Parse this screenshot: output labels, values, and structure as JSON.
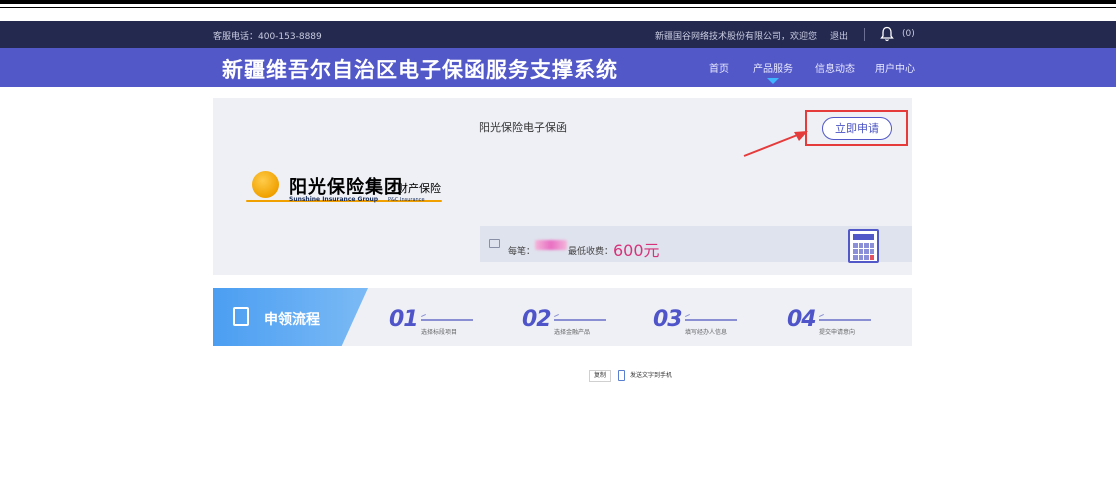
{
  "topbar": {
    "phone": "客服电话：400-153-8889",
    "welcome": "新疆国谷网络技术股份有限公司，欢迎您",
    "logout": "退出",
    "notifications": "(0)"
  },
  "nav": {
    "site_title": "新疆维吾尔自治区电子保函服务支撑系统",
    "items": [
      "首页",
      "产品服务",
      "信息动态",
      "用户中心"
    ],
    "active": "产品服务"
  },
  "product": {
    "name": "阳光保险电子保函",
    "apply_label": "立即申请",
    "logo_cn": "阳光保险集团",
    "logo_cn_sub": "财产保险",
    "logo_en": "Sunshine Insurance Group",
    "logo_en_sub": "P&C Insurance",
    "fee_label": "每笔：",
    "min_fee_label": "最低收费：",
    "min_fee": "600元"
  },
  "process": {
    "title": "申领流程",
    "steps": [
      {
        "num": "01",
        "label": "选择标段项目"
      },
      {
        "num": "02",
        "label": "选择金融产品"
      },
      {
        "num": "03",
        "label": "填写经办人信息"
      },
      {
        "num": "04",
        "label": "提交申请意向"
      }
    ]
  },
  "share": {
    "copy": "复制",
    "send": "发送文字到手机"
  },
  "colors": {
    "utility_bar": "#24294f",
    "nav_bar": "#5358c8",
    "highlight": "#e53b3b",
    "fee_amount": "#d6337a",
    "step_number": "#4f55c9"
  }
}
